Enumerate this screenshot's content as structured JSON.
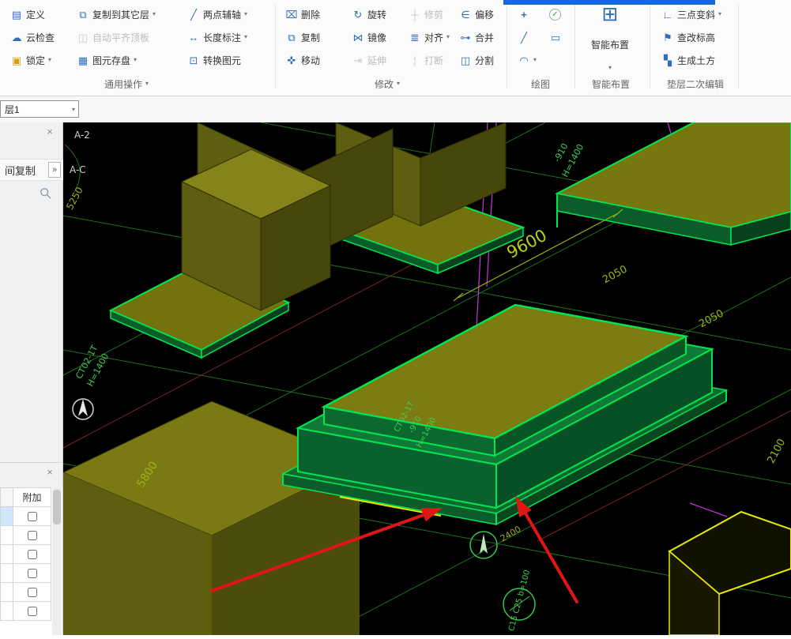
{
  "window": {
    "accent_color": "#1668d9"
  },
  "icons": {
    "caret": "▾",
    "close": "×",
    "expand": "»",
    "define": "▤",
    "copy_to_layers": "⧉",
    "two_point_aux": "╱",
    "cloud_check": "☁",
    "auto_align_slab": "◫",
    "length_dim": "↔",
    "lock": "▣",
    "save_element": "▦",
    "convert_element": "⊡",
    "delete": "⌧",
    "rotate": "↻",
    "trim": "┼",
    "offset": "∈",
    "copy": "⧉",
    "mirror": "⋈",
    "align": "≣",
    "merge": "⊶",
    "move": "✜",
    "extend": "⇥",
    "break": "¦",
    "split": "◫",
    "point_tool": "+",
    "check_tool": "✓",
    "line_tool": "╱",
    "rect_tool": "▭",
    "arc_tool": "◠",
    "smart_grid": "⊞",
    "three_point_slope": "∟",
    "check_elevation": "⚑",
    "generate_earthwork": "▚"
  },
  "ribbon": {
    "general_ops": {
      "label": "通用操作",
      "define": "定义",
      "copy_to_other_layers": "复制到其它层",
      "two_point_aux_axis": "两点辅轴",
      "cloud_check": "云检查",
      "auto_align_top_slab": "自动平齐顶板",
      "length_dimension": "长度标注",
      "lock": "锁定",
      "save_element": "图元存盘",
      "convert_element": "转换图元"
    },
    "modify": {
      "label": "修改",
      "delete": "删除",
      "rotate": "旋转",
      "trim": "修剪",
      "offset": "偏移",
      "copy": "复制",
      "mirror": "镜像",
      "align": "对齐",
      "merge": "合并",
      "move": "移动",
      "extend": "延伸",
      "break": "打断",
      "split": "分割"
    },
    "draw": {
      "label": "绘图"
    },
    "smart_layout": {
      "label": "智能布置",
      "button_label": "智能布置"
    },
    "cushion_edit": {
      "label": "垫层二次编辑",
      "three_point_slope": "三点变斜",
      "check_modify_elevation": "查改标高",
      "generate_earthwork": "生成土方"
    }
  },
  "layer_bar": {
    "current_layer": "层1"
  },
  "left_panel": {
    "copy_between_floors": "间复制"
  },
  "attributes_panel": {
    "header": "附加",
    "checkbox_rows": 6
  },
  "canvas": {
    "axis_labels": {
      "a2": "A-2",
      "ac": "A-C"
    },
    "dimensions": {
      "d5250": "5250",
      "d9600": "9600",
      "d2050_1": "2050",
      "d2050_2": "2050",
      "d2100": "2100",
      "d5800": "5800",
      "d2400": "2400"
    },
    "labels": {
      "top_right_elevation": "-910",
      "top_right_height": "H=1400",
      "left_footing_id": "CT02-1T",
      "left_footing_height": "H=1400",
      "center_footing_id": "CT02-1T",
      "center_elevation": "-910",
      "center_height": "H=1400",
      "cushion_note": "C15 C25 b=100"
    },
    "colors": {
      "selection_green": "#00e651",
      "model_olive": "#77770f",
      "dimension_green": "#9db313",
      "axis_purple": "#c438d8",
      "annotation_red": "#e01616",
      "cushion_yellow": "#e8e800"
    }
  }
}
